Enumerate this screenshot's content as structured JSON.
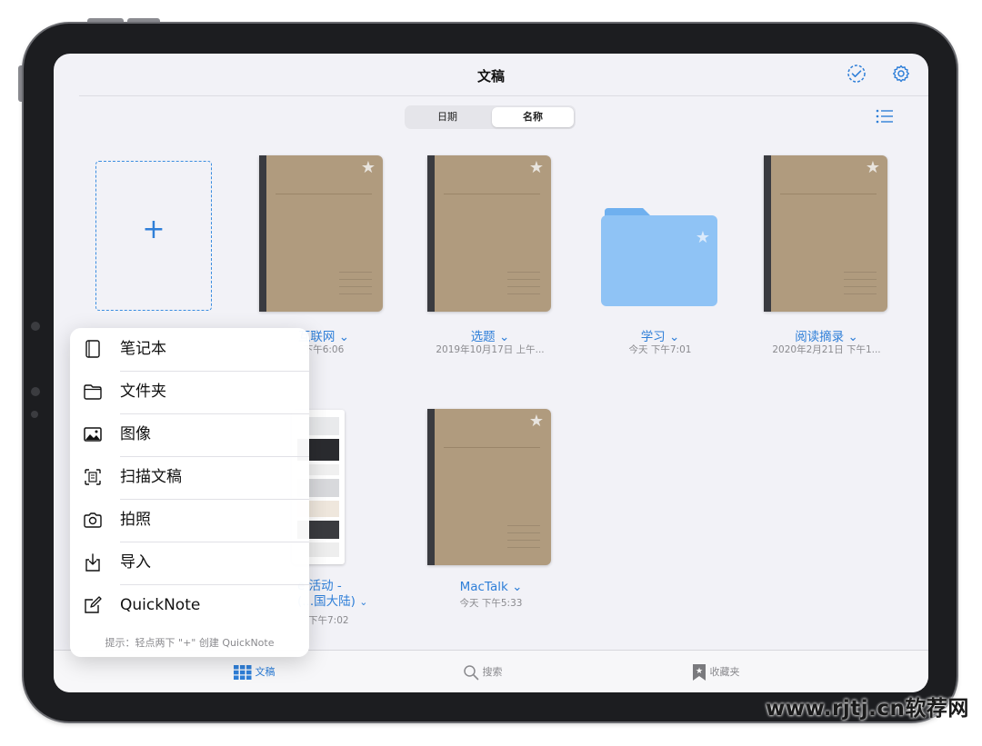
{
  "header": {
    "title": "文稿",
    "sort_tabs": [
      {
        "label": "日期",
        "selected": false
      },
      {
        "label": "名称",
        "selected": true
      }
    ],
    "select_icon": "checkmark-circle-dashed-icon",
    "settings_icon": "gear-icon",
    "view_icon": "list-icon"
  },
  "items": [
    {
      "name": "互联网",
      "date": "下午6:06",
      "kind": "notebook"
    },
    {
      "name": "选题",
      "date": "2019年10月17日 上午...",
      "kind": "notebook"
    },
    {
      "name": "学习",
      "date": "今天 下午7:01",
      "kind": "folder"
    },
    {
      "name": "阅读摘录",
      "date": "2020年2月21日 下午1...",
      "kind": "notebook"
    },
    {
      "name_line1": "e 活动 -",
      "name_line2": "(...国大陆)",
      "date": "下午7:02",
      "kind": "document"
    },
    {
      "name": "MacTalk",
      "date": "今天 下午5:33",
      "kind": "notebook"
    }
  ],
  "chevron": "⌄",
  "new_button": {
    "symbol": "+"
  },
  "create_menu": {
    "items": [
      {
        "label": "笔记本",
        "icon": "notebook-icon"
      },
      {
        "label": "文件夹",
        "icon": "folder-icon"
      },
      {
        "label": "图像",
        "icon": "image-icon"
      },
      {
        "label": "扫描文稿",
        "icon": "scan-icon"
      },
      {
        "label": "拍照",
        "icon": "camera-icon"
      },
      {
        "label": "导入",
        "icon": "import-icon"
      },
      {
        "label": "QuickNote",
        "icon": "quicknote-icon"
      }
    ],
    "hint": "提示：轻点两下 \"+\" 创建 QuickNote"
  },
  "tabbar": {
    "tabs": [
      {
        "label": "文稿",
        "icon": "grid-icon",
        "active": true
      },
      {
        "label": "搜索",
        "icon": "search-icon",
        "active": false
      },
      {
        "label": "收藏夹",
        "icon": "bookmark-star-icon",
        "active": false
      }
    ]
  },
  "colors": {
    "accent": "#2f7fd8",
    "notebook": "#b09b7e",
    "folder": "#8fc3f5",
    "background": "#f2f2f7"
  },
  "watermark": "www.rjtj.cn软荐网"
}
